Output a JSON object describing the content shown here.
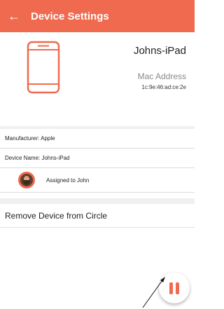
{
  "appbar": {
    "back_icon": "arrow-back-icon",
    "title": "Device Settings",
    "color": "#f06a4f"
  },
  "device": {
    "icon": "phone-icon",
    "name": "Johns-iPad",
    "mac_label": "Mac Address",
    "mac_value": "1c:9e:46:ad:ce:2e"
  },
  "info": {
    "manufacturer": "Manufacturer: Apple",
    "device_name": "Device Name: Johns-iPad",
    "assigned": "Assigned to John"
  },
  "actions": {
    "remove": "Remove Device from Circle"
  },
  "fab": {
    "icon": "pause-icon"
  }
}
